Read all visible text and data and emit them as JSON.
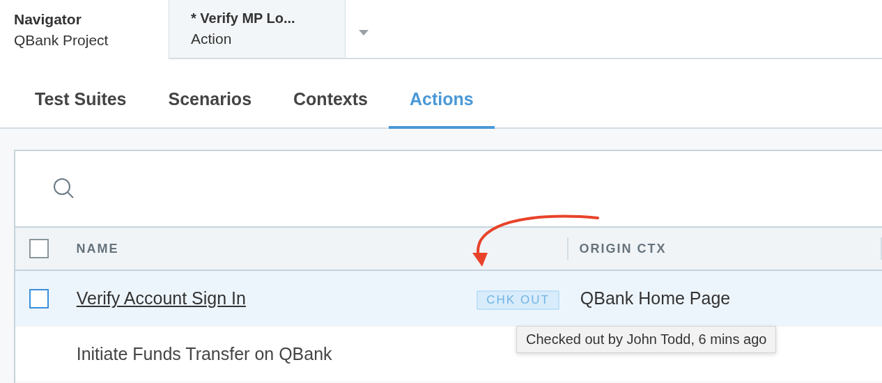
{
  "navigator": {
    "title": "Navigator",
    "project": "QBank Project"
  },
  "document_tab": {
    "title": "* Verify MP Lo...",
    "subtitle": "Action"
  },
  "tabs": [
    {
      "label": "Test Suites",
      "selected": false
    },
    {
      "label": "Scenarios",
      "selected": false
    },
    {
      "label": "Contexts",
      "selected": false
    },
    {
      "label": "Actions",
      "selected": true
    }
  ],
  "table": {
    "columns": [
      "NAME",
      "ORIGIN CTX"
    ],
    "header_checkbox": {
      "checked": false
    },
    "rows": [
      {
        "name": "Verify Account Sign In",
        "badge": "CHK OUT",
        "origin_ctx": "QBank Home Page",
        "selected": true,
        "checked": false
      },
      {
        "name": "Initiate Funds Transfer on QBank",
        "selected": false
      }
    ]
  },
  "tooltip": "Checked out by John Todd, 6 mins ago"
}
